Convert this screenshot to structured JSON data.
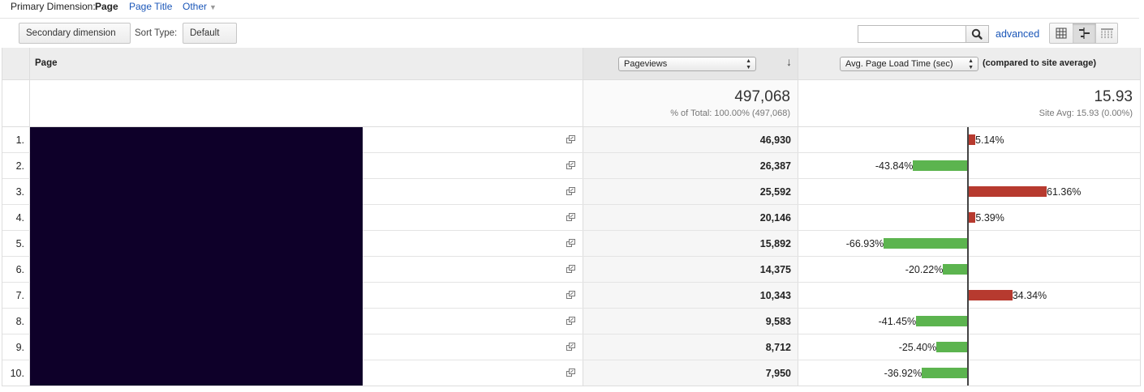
{
  "primary_dimension": {
    "label": "Primary Dimension:",
    "active": "Page",
    "options": [
      "Page Title",
      "Other"
    ]
  },
  "toolbar": {
    "secondary_dimension": "Secondary dimension",
    "sort_type_label": "Sort Type:",
    "sort_type_value": "Default",
    "search_value": "",
    "advanced_label": "advanced"
  },
  "table": {
    "page_header": "Page",
    "metric_select": "Pageviews",
    "compare_select": "Avg. Page Load Time (sec)",
    "compare_label": "(compared to site average)",
    "totals": {
      "pageviews": "497,068",
      "pageviews_sub": "% of Total: 100.00% (497,068)",
      "load_time": "15.93",
      "load_time_sub": "Site Avg: 15.93 (0.00%)"
    },
    "rows": [
      {
        "index": "1.",
        "pageviews": "46,930",
        "delta": 5.14,
        "delta_label": "5.14%"
      },
      {
        "index": "2.",
        "pageviews": "26,387",
        "delta": -43.84,
        "delta_label": "-43.84%"
      },
      {
        "index": "3.",
        "pageviews": "25,592",
        "delta": 61.36,
        "delta_label": "61.36%"
      },
      {
        "index": "4.",
        "pageviews": "20,146",
        "delta": 5.39,
        "delta_label": "5.39%"
      },
      {
        "index": "5.",
        "pageviews": "15,892",
        "delta": -66.93,
        "delta_label": "-66.93%"
      },
      {
        "index": "6.",
        "pageviews": "14,375",
        "delta": -20.22,
        "delta_label": "-20.22%"
      },
      {
        "index": "7.",
        "pageviews": "10,343",
        "delta": 34.34,
        "delta_label": "34.34%"
      },
      {
        "index": "8.",
        "pageviews": "9,583",
        "delta": -41.45,
        "delta_label": "-41.45%"
      },
      {
        "index": "9.",
        "pageviews": "8,712",
        "delta": -25.4,
        "delta_label": "-25.40%"
      },
      {
        "index": "10.",
        "pageviews": "7,950",
        "delta": -36.92,
        "delta_label": "-36.92%"
      }
    ]
  },
  "colors": {
    "above_average": "#b73a2f",
    "below_average": "#5cb44f",
    "link": "#1a56b8",
    "redaction": "#0e0029"
  },
  "icons": [
    "search-icon",
    "table-view-icon",
    "comparison-view-icon",
    "pivot-view-icon",
    "open-page-icon",
    "sort-descending-icon"
  ]
}
